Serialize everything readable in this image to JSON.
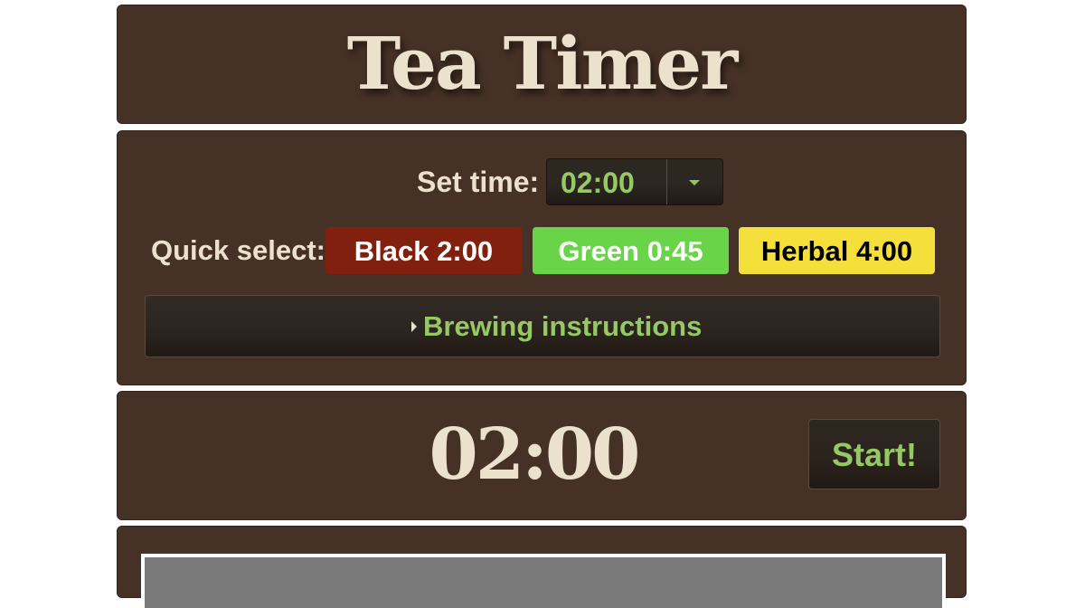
{
  "app": {
    "title": "Tea Timer"
  },
  "settings": {
    "set_time_label": "Set time:",
    "set_time_value": "02:00",
    "quick_select_label": "Quick select:",
    "quick_buttons": [
      {
        "label": "Black 2:00",
        "color": "#822010"
      },
      {
        "label": "Green 0:45",
        "color": "#6ad448"
      },
      {
        "label": "Herbal 4:00",
        "color": "#f5e03b"
      }
    ],
    "instructions_label": "Brewing instructions",
    "dropdown_icon": "chevron-down-icon",
    "instructions_icon": "caret-right-icon"
  },
  "timer": {
    "display": "02:00",
    "start_label": "Start!"
  },
  "colors": {
    "panel_background": "#463126",
    "accent_text": "#96c864",
    "primary_text": "#ebe1cd"
  }
}
